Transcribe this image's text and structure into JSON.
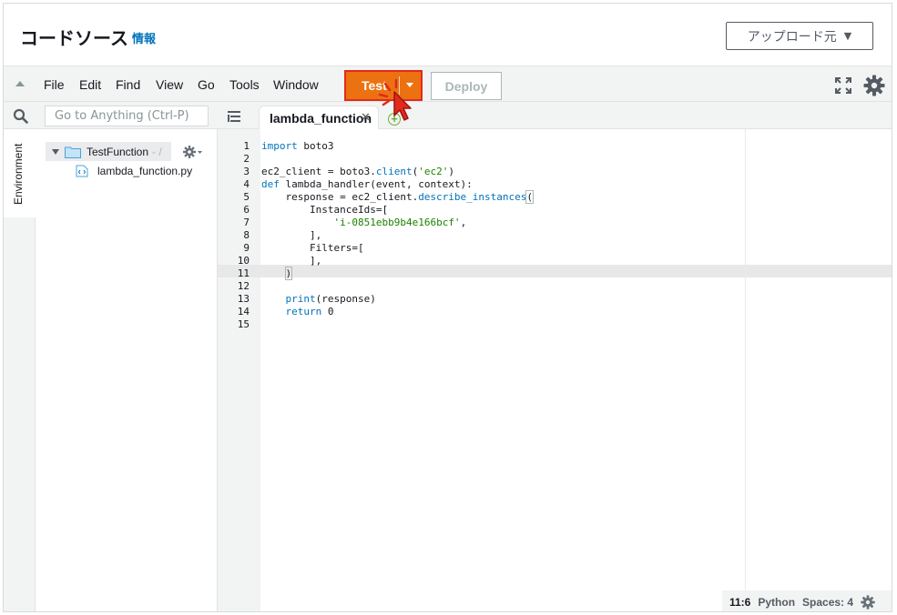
{
  "header": {
    "title": "コードソース",
    "info_link": "情報",
    "upload_button": "アップロード元"
  },
  "menu": {
    "items": [
      "File",
      "Edit",
      "Find",
      "View",
      "Go",
      "Tools",
      "Window"
    ],
    "test_button": "Test",
    "deploy_button": "Deploy"
  },
  "sidebar": {
    "search_placeholder": "Go to Anything (Ctrl-P)",
    "environment_tab": "Environment",
    "tree": {
      "root_name": "TestFunction",
      "root_path": "- /",
      "file_name": "lambda_function.py"
    }
  },
  "editor": {
    "tab_label": "lambda_function",
    "lines": [
      "import boto3",
      "",
      "ec2_client = boto3.client('ec2')",
      "def lambda_handler(event, context):",
      "    response = ec2_client.describe_instances(",
      "        InstanceIds=[",
      "            'i-0851ebb9b4e166bcf',",
      "        ],",
      "        Filters=[",
      "        ],",
      "    )",
      "",
      "    print(response)",
      "    return 0",
      ""
    ],
    "line_numbers": [
      "1",
      "2",
      "3",
      "4",
      "5",
      "6",
      "7",
      "8",
      "9",
      "10",
      "11",
      "12",
      "13",
      "14",
      "15"
    ]
  },
  "status": {
    "cursor": "11:6",
    "language": "Python",
    "indent": "Spaces: 4"
  },
  "colors": {
    "accent_orange": "#ec7211",
    "highlight_red": "#e3281d",
    "link_blue": "#0073bb",
    "string_green": "#1d8102"
  }
}
